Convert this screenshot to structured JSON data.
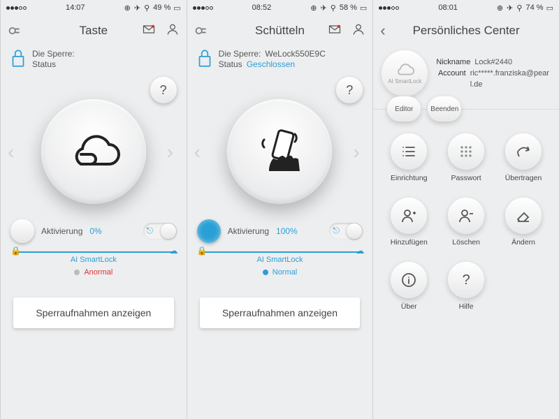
{
  "panes": [
    {
      "status": {
        "time": "14:07",
        "battery": "49 %",
        "carrier_dots": 3
      },
      "title": "Taste",
      "lock": {
        "label": "Die Sperre:",
        "name": "",
        "status_label": "Status",
        "status_value": ""
      },
      "activation": {
        "label": "Aktivierung",
        "percent": "0%",
        "active": false
      },
      "smartbar_label": "AI SmartLock",
      "status_text": "Anormal",
      "status_kind": "anormal",
      "cta": "Sperraufnahmen anzeigen",
      "center_mode": "cloud"
    },
    {
      "status": {
        "time": "08:52",
        "battery": "58 %",
        "carrier_dots": 3
      },
      "title": "Schütteln",
      "lock": {
        "label": "Die Sperre:",
        "name": "WeLock550E9C",
        "status_label": "Status",
        "status_value": "Geschlossen"
      },
      "activation": {
        "label": "Aktivierung",
        "percent": "100%",
        "active": true
      },
      "smartbar_label": "AI SmartLock",
      "status_text": "Normal",
      "status_kind": "normal",
      "cta": "Sperraufnahmen anzeigen",
      "center_mode": "shake"
    },
    {
      "status": {
        "time": "08:01",
        "battery": "74 %",
        "carrier_dots": 3
      },
      "title": "Persönliches Center",
      "profile": {
        "nickname_label": "Nickname",
        "nickname": "Lock#2440",
        "account_label": "Account",
        "account": "ric*****.franziska@pearl.de",
        "avatar_caption": "AI SmartLock",
        "editor": "Editor",
        "logout": "Beenden"
      },
      "actions": [
        {
          "key": "setup",
          "label": "Einrichtung",
          "icon": "list"
        },
        {
          "key": "password",
          "label": "Passwort",
          "icon": "dots"
        },
        {
          "key": "transfer",
          "label": "Übertragen",
          "icon": "share"
        },
        {
          "key": "add",
          "label": "Hinzufügen",
          "icon": "userplus"
        },
        {
          "key": "delete",
          "label": "Löschen",
          "icon": "userminus"
        },
        {
          "key": "edit",
          "label": "Ändern",
          "icon": "eraser"
        },
        {
          "key": "about",
          "label": "Über",
          "icon": "info"
        },
        {
          "key": "help",
          "label": "Hilfe",
          "icon": "question"
        }
      ]
    }
  ]
}
